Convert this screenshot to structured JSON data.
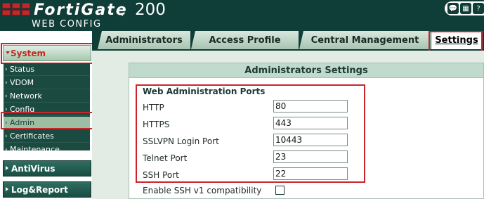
{
  "header": {
    "brand": "FortiGate",
    "model": "200",
    "subtitle": "WEB CONFIG",
    "icons": [
      "chat-icon",
      "save-icon",
      "help-icon"
    ]
  },
  "sidebar": {
    "system": "System",
    "items": [
      "Status",
      "VDOM",
      "Network",
      "Config",
      "Admin",
      "Certificates",
      "Maintenance"
    ],
    "active_item": "Admin",
    "sections": [
      "AntiVirus",
      "Log&Report"
    ]
  },
  "tabs": {
    "items": [
      "Administrators",
      "Access Profile",
      "Central Management",
      "Settings"
    ],
    "active": "Settings"
  },
  "panel": {
    "title": "Administrators Settings",
    "ports_title": "Web Administration Ports",
    "rows": [
      {
        "label": "HTTP",
        "value": "80"
      },
      {
        "label": "HTTPS",
        "value": "443"
      },
      {
        "label": "SSLVPN Login Port",
        "value": "10443"
      },
      {
        "label": "Telnet Port",
        "value": "23"
      },
      {
        "label": "SSH Port",
        "value": "22"
      }
    ],
    "ssh_v1_label": "Enable SSH v1 compatibility",
    "ssh_v1_checked": false
  },
  "colors": {
    "header_bg": "#0f3d38",
    "highlight": "#c8262b",
    "accent_text": "#c22a1d"
  }
}
